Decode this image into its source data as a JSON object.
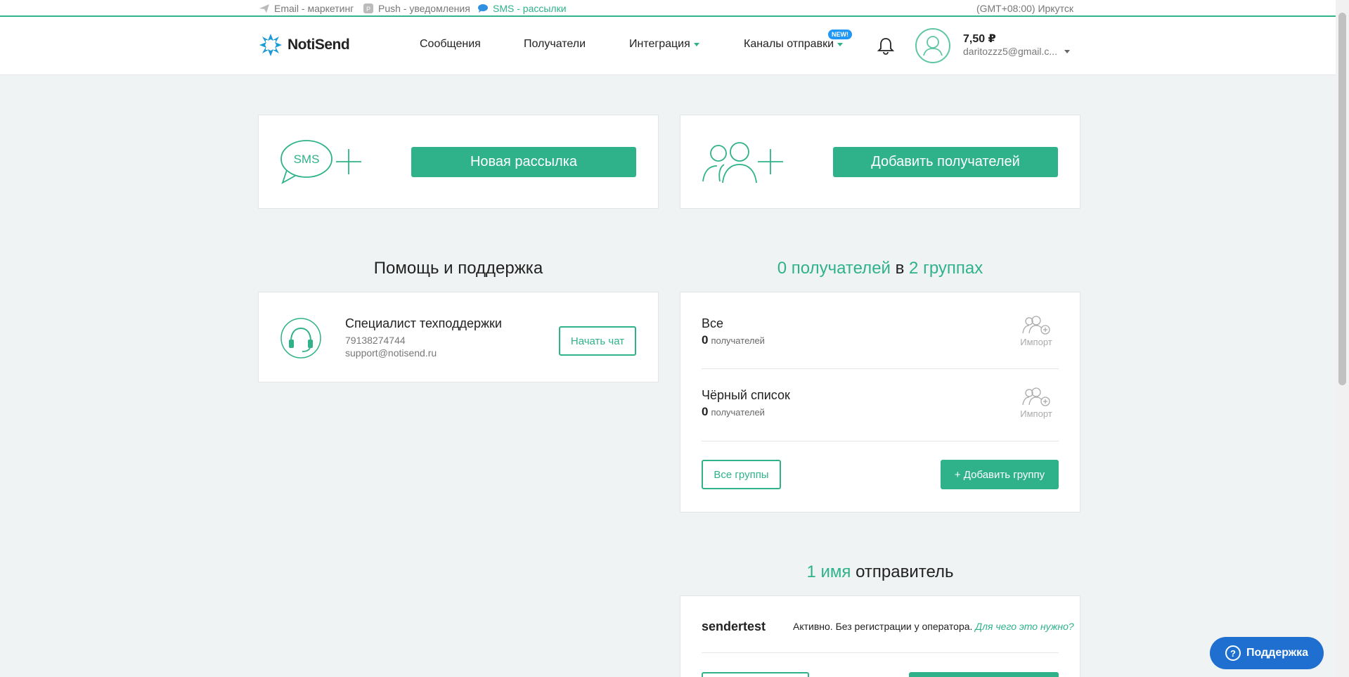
{
  "topstrip": {
    "channels": [
      {
        "label": "Email - маркетинг",
        "icon": "paper-plane-icon"
      },
      {
        "label": "Push - уведомления",
        "icon": "push-icon"
      },
      {
        "label": "SMS - рассылки",
        "icon": "chat-bubble-icon",
        "active": true
      }
    ],
    "timezone": "(GMT+08:00) Иркутск"
  },
  "header": {
    "logo_text": "NotiSend",
    "nav": [
      {
        "label": "Сообщения"
      },
      {
        "label": "Получатели"
      },
      {
        "label": "Интеграция"
      },
      {
        "label": "Каналы отправки"
      }
    ],
    "new_badge": "NEW!",
    "balance": "7,50 ₽",
    "email": "daritozzz5@gmail.c..."
  },
  "actions": {
    "sms_icon_text": "SMS",
    "new_mailing": "Новая рассылка",
    "add_recipients": "Добавить получателей"
  },
  "support": {
    "title": "Помощь и поддержка",
    "name": "Специалист техподдержки",
    "phone": "79138274744",
    "email": "support@notisend.ru",
    "chat_button": "Начать чат"
  },
  "recipients": {
    "title_count": "0 получателей",
    "title_mid": "в",
    "title_groups": "2 группах",
    "groups": [
      {
        "name": "Все",
        "count": "0",
        "unit": "получателей",
        "import": "Импорт"
      },
      {
        "name": "Чёрный список",
        "count": "0",
        "unit": "получателей",
        "import": "Импорт"
      }
    ],
    "all_groups": "Все группы",
    "add_group": "+ Добавить группу"
  },
  "senders": {
    "title_count": "1 имя",
    "title_rest": "отправитель",
    "name": "sendertest",
    "status": "Активно. Без регистрации у оператора.",
    "link": "Для чего это нужно?"
  },
  "float": {
    "support": "Поддержка"
  },
  "colors": {
    "accent": "#2fb28a",
    "support_button": "#1f6fd0",
    "new_badge": "#2196f3"
  }
}
